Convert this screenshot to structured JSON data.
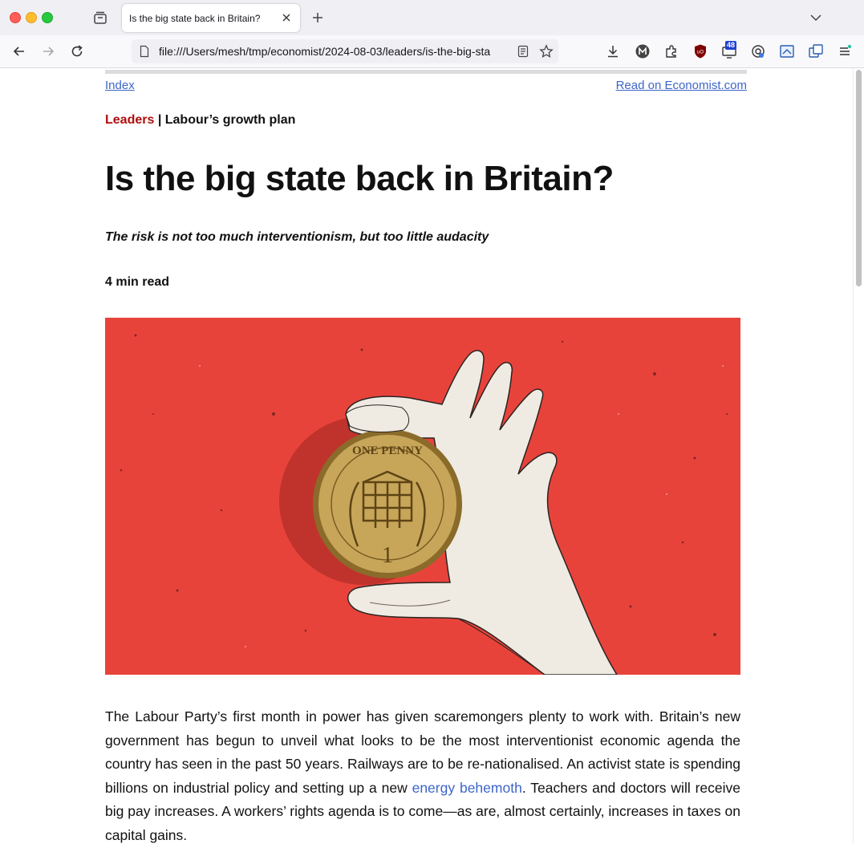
{
  "browser": {
    "tab_title": "Is the big state back in Britain?",
    "url": "file:///Users/mesh/tmp/economist/2024-08-03/leaders/is-the-big-sta",
    "notification_badge": "48"
  },
  "nav": {
    "index_label": "Index",
    "economist_label": "Read on Economist.com"
  },
  "article": {
    "section": "Leaders",
    "separator": " | ",
    "rubric": "Labour’s growth plan",
    "headline": "Is the big state back in Britain?",
    "subheadline": "The risk is not too much interventionism, but too little audacity",
    "read_time": "4 min read",
    "image_coin_text_top": "ONE PENNY",
    "image_coin_numeral": "1",
    "body_part1": "The Labour Party’s first month in power has given scaremongers plenty to work with. Britain’s new government has begun to unveil what looks to be the most interventionist economic agenda the country has seen in the past 50 years. Railways are to be re-nationalised. An activist state is spending billions on industrial policy and setting up a new ",
    "body_link": "energy behemoth",
    "body_part2": ". Teachers and doc­tors will receive big pay increases. A workers’ rights agenda is to come—as are, almost certainly, increases in taxes on capital gains."
  },
  "colors": {
    "hero_bg": "#e8433b",
    "section_red": "#b00d0d",
    "link_blue": "#3d65c8"
  }
}
